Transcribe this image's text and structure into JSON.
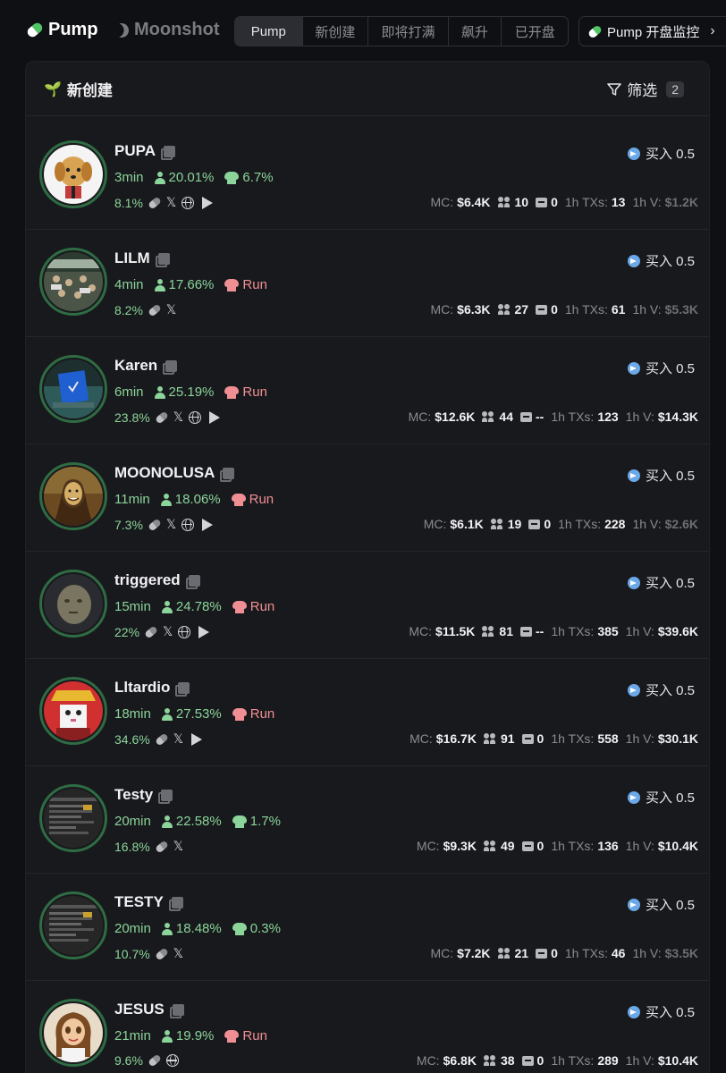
{
  "header": {
    "brand": "Pump",
    "brand_secondary": "Moonshot",
    "tabs": [
      "Pump",
      "新创建",
      "即将打满",
      "飙升",
      "已开盘"
    ],
    "active_tab": "Pump",
    "monitor_label": "Pump 开盘监控"
  },
  "panel": {
    "title": "新创建",
    "filter_label": "筛选",
    "filter_count": "2"
  },
  "tokens": [
    {
      "name": "PUPA",
      "age": "3min",
      "holders_pct": "20.01%",
      "dev_label": "6.7%",
      "dev_status": "dev",
      "progress": "8.1%",
      "links": [
        "pill",
        "x",
        "web",
        "tg"
      ],
      "buy": "买入 0.5",
      "mc": "$6.4K",
      "holders": "10",
      "replies": "0",
      "txs": "13",
      "vol": "$1.2K",
      "vol_muted": true
    },
    {
      "name": "LILM",
      "age": "4min",
      "holders_pct": "17.66%",
      "dev_label": "Run",
      "dev_status": "run",
      "progress": "8.2%",
      "links": [
        "pill",
        "x"
      ],
      "buy": "买入 0.5",
      "mc": "$6.3K",
      "holders": "27",
      "replies": "0",
      "txs": "61",
      "vol": "$5.3K",
      "vol_muted": true
    },
    {
      "name": "Karen",
      "age": "6min",
      "holders_pct": "25.19%",
      "dev_label": "Run",
      "dev_status": "run",
      "progress": "23.8%",
      "links": [
        "pill",
        "x",
        "web",
        "tg"
      ],
      "buy": "买入 0.5",
      "mc": "$12.6K",
      "holders": "44",
      "replies": "--",
      "txs": "123",
      "vol": "$14.3K",
      "vol_muted": false
    },
    {
      "name": "MOONOLUSA",
      "age": "11min",
      "holders_pct": "18.06%",
      "dev_label": "Run",
      "dev_status": "run",
      "progress": "7.3%",
      "links": [
        "pill",
        "x",
        "web",
        "tg"
      ],
      "buy": "买入 0.5",
      "mc": "$6.1K",
      "holders": "19",
      "replies": "0",
      "txs": "228",
      "vol": "$2.6K",
      "vol_muted": true
    },
    {
      "name": "triggered",
      "age": "15min",
      "holders_pct": "24.78%",
      "dev_label": "Run",
      "dev_status": "run",
      "progress": "22%",
      "links": [
        "pill",
        "x",
        "web",
        "tg"
      ],
      "buy": "买入 0.5",
      "mc": "$11.5K",
      "holders": "81",
      "replies": "--",
      "txs": "385",
      "vol": "$39.6K",
      "vol_muted": false
    },
    {
      "name": "Lltardio",
      "age": "18min",
      "holders_pct": "27.53%",
      "dev_label": "Run",
      "dev_status": "run",
      "progress": "34.6%",
      "links": [
        "pill",
        "x",
        "tg"
      ],
      "buy": "买入 0.5",
      "mc": "$16.7K",
      "holders": "91",
      "replies": "0",
      "txs": "558",
      "vol": "$30.1K",
      "vol_muted": false
    },
    {
      "name": "Testy",
      "age": "20min",
      "holders_pct": "22.58%",
      "dev_label": "1.7%",
      "dev_status": "dev",
      "progress": "16.8%",
      "links": [
        "pill",
        "x"
      ],
      "buy": "买入 0.5",
      "mc": "$9.3K",
      "holders": "49",
      "replies": "0",
      "txs": "136",
      "vol": "$10.4K",
      "vol_muted": false
    },
    {
      "name": "TESTY",
      "age": "20min",
      "holders_pct": "18.48%",
      "dev_label": "0.3%",
      "dev_status": "dev",
      "progress": "10.7%",
      "links": [
        "pill",
        "x"
      ],
      "buy": "买入 0.5",
      "mc": "$7.2K",
      "holders": "21",
      "replies": "0",
      "txs": "46",
      "vol": "$3.5K",
      "vol_muted": true
    },
    {
      "name": "JESUS",
      "age": "21min",
      "holders_pct": "19.9%",
      "dev_label": "Run",
      "dev_status": "run",
      "progress": "9.6%",
      "links": [
        "pill",
        "web"
      ],
      "buy": "买入 0.5",
      "mc": "$6.8K",
      "holders": "38",
      "replies": "0",
      "txs": "289",
      "vol": "$10.4K",
      "vol_muted": false
    }
  ],
  "labels": {
    "mc": "MC:",
    "txs": "1h TXs:",
    "vol": "1h V:"
  },
  "avatar_styles": [
    "dog",
    "crowd",
    "screen",
    "mona",
    "meme",
    "cat",
    "doc",
    "doc",
    "doll"
  ],
  "colors": {
    "accent_green": "#8bd49a",
    "run_red": "#ef8f93",
    "telegram_blue": "#6aa8e8",
    "panel_bg": "#18191d"
  }
}
